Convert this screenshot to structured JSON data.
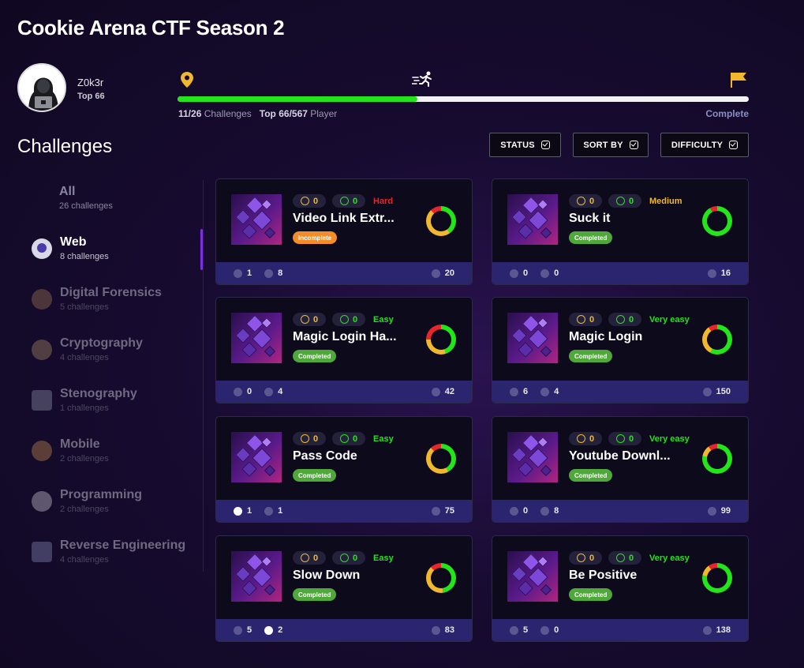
{
  "app": {
    "title": "Cookie Arena CTF Season 2"
  },
  "user": {
    "name": "Z0k3r",
    "rank": "Top 66"
  },
  "progress": {
    "fraction": 0.42,
    "solved": "11/26",
    "solved_label": "Challenges",
    "rank": "Top 66/567",
    "rank_label": "Player",
    "complete_label": "Complete"
  },
  "section_title": "Challenges",
  "filters": {
    "status": "STATUS",
    "sort": "SORT BY",
    "difficulty": "DIFFICULTY"
  },
  "categories": [
    {
      "name": "All",
      "count": "26 challenges"
    },
    {
      "name": "Web",
      "count": "8 challenges"
    },
    {
      "name": "Digital Forensics",
      "count": "5 challenges"
    },
    {
      "name": "Cryptography",
      "count": "4 challenges"
    },
    {
      "name": "Stenography",
      "count": "1 challenges"
    },
    {
      "name": "Mobile",
      "count": "2 challenges"
    },
    {
      "name": "Programming",
      "count": "2 challenges"
    },
    {
      "name": "Reverse Engineering",
      "count": "4 challenges"
    }
  ],
  "colors": {
    "accent_green": "#22e51a",
    "score_yellow": "#f1b82e",
    "hard": "#e5262c",
    "medium": "#f1b82e",
    "easy": "#22e51a",
    "incomplete_badge": "#f28d2a",
    "completed_badge": "#4fa83a",
    "footer": "#2b2570"
  },
  "challenges": [
    {
      "title": "Video Link Extr...",
      "score": "0",
      "coins": "0",
      "difficulty": "Hard",
      "status": "Incomplete",
      "likes": "1",
      "dislikes": "8",
      "players": "20"
    },
    {
      "title": "Suck it",
      "score": "0",
      "coins": "0",
      "difficulty": "Medium",
      "status": "Completed",
      "likes": "0",
      "dislikes": "0",
      "players": "16"
    },
    {
      "title": "Magic Login Ha...",
      "score": "0",
      "coins": "0",
      "difficulty": "Easy",
      "status": "Completed",
      "likes": "0",
      "dislikes": "4",
      "players": "42"
    },
    {
      "title": "Magic Login",
      "score": "0",
      "coins": "0",
      "difficulty": "Very easy",
      "status": "Completed",
      "likes": "6",
      "dislikes": "4",
      "players": "150"
    },
    {
      "title": "Pass Code",
      "score": "0",
      "coins": "0",
      "difficulty": "Easy",
      "status": "Completed",
      "likes": "1",
      "dislikes": "1",
      "players": "75"
    },
    {
      "title": "Youtube Downl...",
      "score": "0",
      "coins": "0",
      "difficulty": "Very easy",
      "status": "Completed",
      "likes": "0",
      "dislikes": "8",
      "players": "99"
    },
    {
      "title": "Slow Down",
      "score": "0",
      "coins": "0",
      "difficulty": "Easy",
      "status": "Completed",
      "likes": "5",
      "dislikes": "2",
      "players": "83"
    },
    {
      "title": "Be Positive",
      "score": "0",
      "coins": "0",
      "difficulty": "Very easy",
      "status": "Completed",
      "likes": "5",
      "dislikes": "0",
      "players": "138"
    }
  ]
}
